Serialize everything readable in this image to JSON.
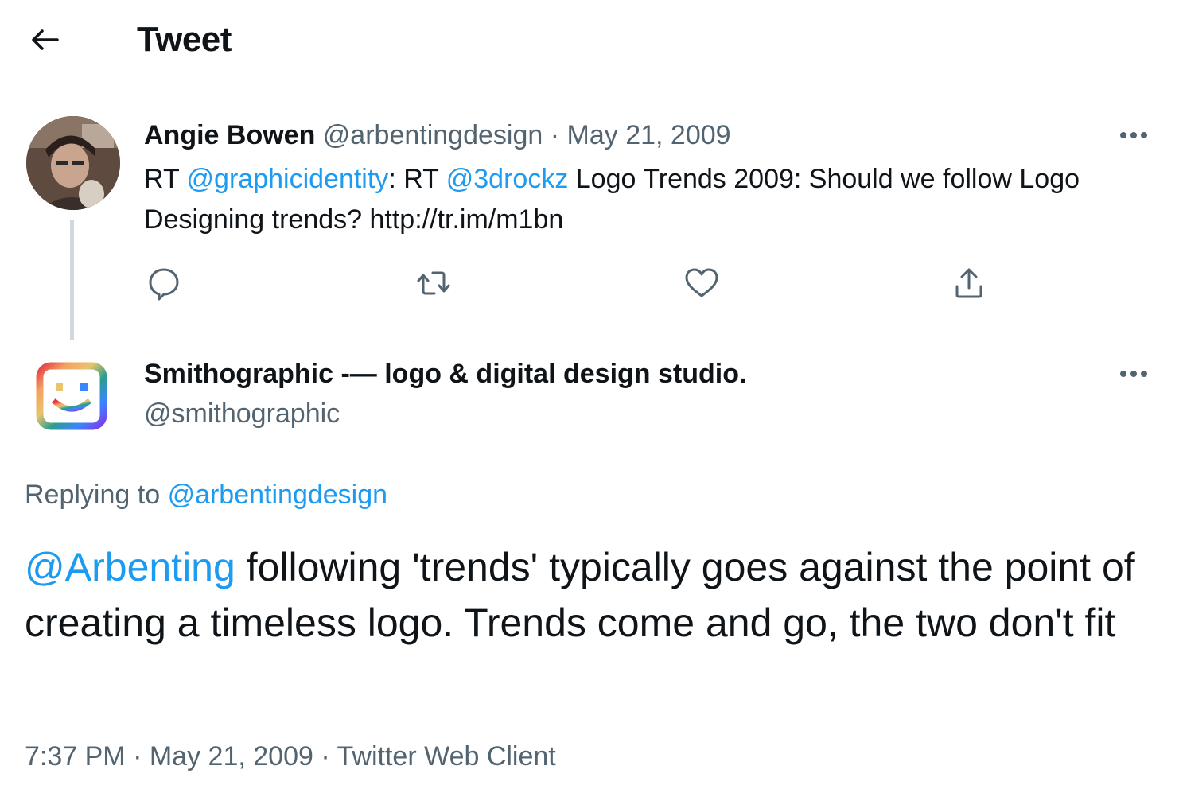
{
  "header": {
    "title": "Tweet"
  },
  "parent_tweet": {
    "author_name": "Angie Bowen",
    "author_handle": "@arbentingdesign",
    "separator": "·",
    "date": "May 21, 2009",
    "text_parts": [
      {
        "text": "RT ",
        "link": false
      },
      {
        "text": "@graphicidentity",
        "link": true
      },
      {
        "text": ": RT ",
        "link": false
      },
      {
        "text": "@3drockz",
        "link": true
      },
      {
        "text": " Logo Trends 2009: Should we follow Logo Designing trends? http://tr.im/m1bn",
        "link": false
      }
    ],
    "actions": [
      "reply-icon",
      "retweet-icon",
      "like-icon",
      "share-icon"
    ]
  },
  "main_tweet": {
    "author_name": "Smithographic -— logo & digital design studio.",
    "author_handle": "@smithographic",
    "replying_label": "Replying to",
    "replying_handle": "@arbentingdesign",
    "text_mention": "@Arbenting",
    "text_body": " following 'trends' typically goes against the point of creating a timeless logo. Trends come and go, the two don't fit",
    "time": "7:37 PM",
    "date": "May 21, 2009",
    "source": "Twitter Web Client",
    "separator": "·"
  },
  "colors": {
    "accent": "#1d9bf0",
    "muted": "#536471",
    "text": "#0f1419",
    "line": "#cfd9de"
  }
}
